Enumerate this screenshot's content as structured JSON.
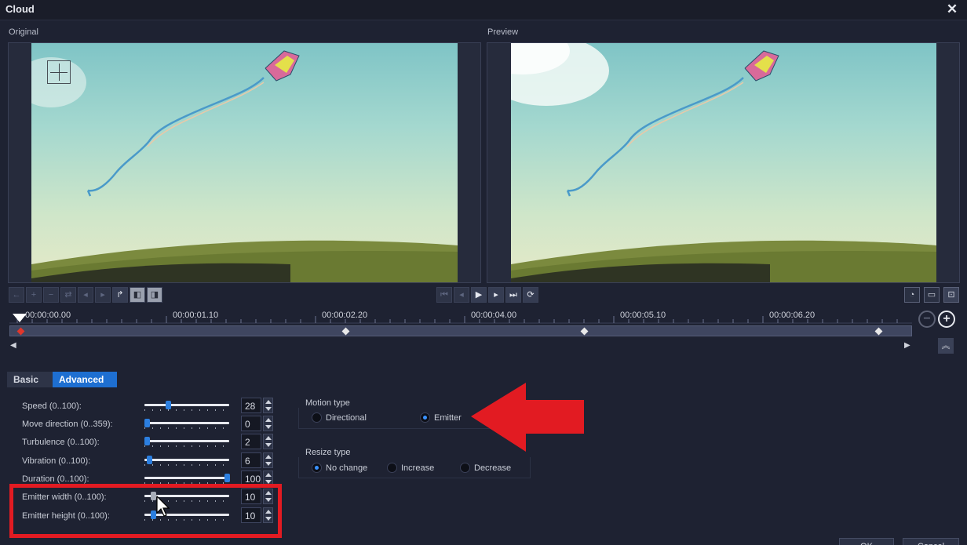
{
  "window": {
    "title": "Cloud",
    "close_icon": "✕"
  },
  "panes": {
    "original_label": "Original",
    "preview_label": "Preview"
  },
  "toolbar_left": {
    "icons": [
      "arrow-left-icon",
      "add-keyframe-icon",
      "remove-keyframe-icon",
      "reverse-keyframes-icon",
      "prev-keyframe-icon",
      "next-keyframe-icon",
      "fade-icon",
      "copy-icon",
      "paste-icon"
    ]
  },
  "transport": {
    "icons": [
      "home-icon",
      "prev-frame-icon",
      "play-icon",
      "next-frame-icon",
      "end-icon",
      "repeat-icon"
    ]
  },
  "view_controls": {
    "icons": [
      "speed-icon",
      "preview-screen-icon",
      "zoom-fit-icon"
    ]
  },
  "timeline": {
    "timecodes": [
      "00:00:00.00",
      "00:00:01.10",
      "00:00:02.20",
      "00:00:04.00",
      "00:00:05.10",
      "00:00:06.20"
    ]
  },
  "tabs": {
    "basic": "Basic",
    "advanced": "Advanced",
    "active": "advanced"
  },
  "params": [
    {
      "label": "Speed (0..100):",
      "value": "28",
      "level": 0.28
    },
    {
      "label": "Move direction (0..359):",
      "value": "0",
      "level": 0.0
    },
    {
      "label": "Turbulence (0..100):",
      "value": "2",
      "level": 0.02
    },
    {
      "label": "Vibration (0..100):",
      "value": "6",
      "level": 0.06
    },
    {
      "label": "Duration (0..100):",
      "value": "100",
      "level": 1.0
    },
    {
      "label": "Emitter width (0..100):",
      "value": "10",
      "level": 0.1
    },
    {
      "label": "Emitter height (0..100):",
      "value": "10",
      "level": 0.1
    }
  ],
  "motion_type": {
    "label": "Motion type",
    "options": [
      "Directional",
      "Emitter"
    ],
    "selected": "Emitter"
  },
  "resize_type": {
    "label": "Resize type",
    "options": [
      "No change",
      "Increase",
      "Decrease"
    ],
    "selected": "No change"
  },
  "footer": {
    "ok": "OK",
    "cancel": "Cancel"
  },
  "colors": {
    "accent": "#1e6fd1",
    "highlight": "#e21b22",
    "background": "#1e2232"
  }
}
